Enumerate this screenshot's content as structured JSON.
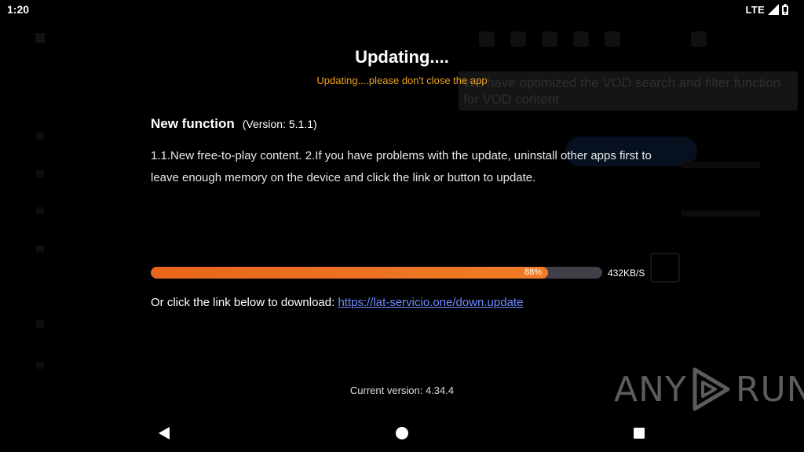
{
  "status_bar": {
    "time": "1:20",
    "network": "LTE",
    "signal_icon": "signal-icon",
    "battery_icon": "battery-icon"
  },
  "background_app": {
    "tooltip_text": "We have optimized the VOD search and filter function for VOD content"
  },
  "dialog": {
    "title": "Updating....",
    "subtitle": "Updating....please don't close the app",
    "section_title": "New function",
    "version_prefix": "(Version: ",
    "version_value": "5.1.1",
    "version_suffix": ")",
    "description": "1.1.New free-to-play content. 2.If you have problems with the update, uninstall other apps first to leave enough memory on the device and click the link or button to update.",
    "progress": {
      "percent": 88,
      "label": "88%",
      "speed": "432KB/S",
      "fill_color": "#ec6e1f",
      "track_color": "#414048"
    },
    "download_prompt": "Or click the link below to download: ",
    "download_link": "https://lat-servicio.one/down.update",
    "current_version_label": "Current version: 4.34.4",
    "accent_color": "#f0a020",
    "link_color": "#6f8cff"
  },
  "watermark": {
    "left_text": "ANY",
    "right_text": "RUN",
    "icon": "play-triangle-icon"
  },
  "nav_bar": {
    "back_icon": "back-triangle-icon",
    "home_icon": "home-circle-icon",
    "recent_icon": "recent-square-icon"
  }
}
